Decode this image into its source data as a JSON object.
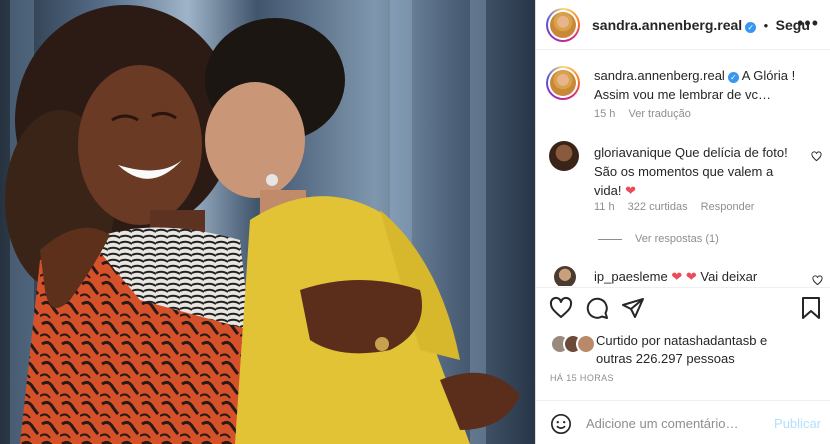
{
  "post": {
    "username": "sandra.annenberg.real",
    "verified": true,
    "follow_label": "Segu",
    "separator": "•",
    "more_icon": "more-dots-icon"
  },
  "caption": {
    "username": "sandra.annenberg.real",
    "text_line1": "A Glória !",
    "text_line2": "Assim vou me lembrar de vc…",
    "time": "15 h",
    "translate": "Ver tradução"
  },
  "comments": [
    {
      "username": "gloriavanique",
      "text_line1": "Que delícia de foto!",
      "text_line2": "São os momentos que valem a",
      "text_line3": "vida!",
      "emoji": "❤",
      "time": "11 h",
      "likes": "322 curtidas",
      "reply": "Responder",
      "view_replies": "Ver respostas (1)"
    },
    {
      "username": "ip_paesleme",
      "emoji": "❤ ❤",
      "text": "Vai deixar"
    }
  ],
  "likes": {
    "text_line1": "Curtido por natashadantasb e",
    "text_line2": "outras 226.297 pessoas"
  },
  "timestamp": "HÁ 15 HORAS",
  "comment_box": {
    "placeholder": "Adicione um comentário…",
    "publish_label": "Publicar"
  },
  "colors": {
    "accent": "#3897f0",
    "publish_disabled": "#b2dffc",
    "heart": "#ed4956"
  }
}
